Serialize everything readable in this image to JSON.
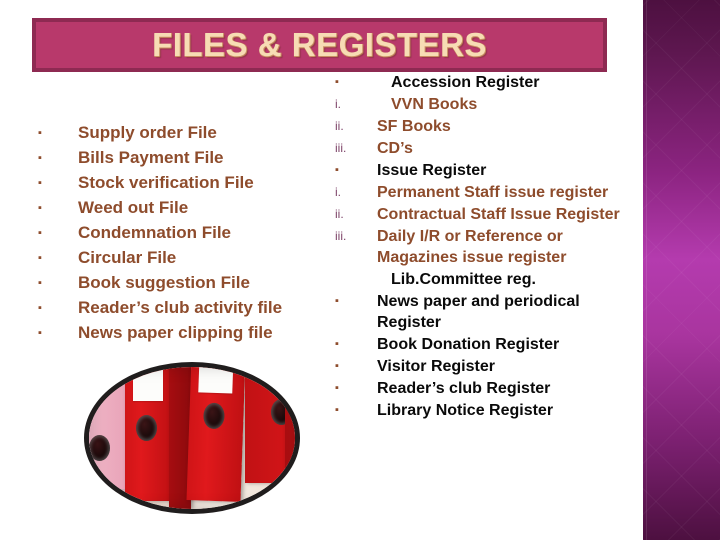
{
  "slide": {
    "title": "FILES & REGISTERS",
    "title_bg": "#b8396b",
    "title_border": "#8e2a52",
    "title_color": "#f7dcb4",
    "brown_text": "#8e4c2c",
    "black_text": "#0a0a0a",
    "band_color": "#b43bae"
  },
  "left_column": {
    "items": [
      {
        "marker": "▪",
        "text": "Supply order File"
      },
      {
        "marker": "▪",
        "text": "Bills Payment File"
      },
      {
        "marker": "▪",
        "text": "Stock verification File"
      },
      {
        "marker": "▪",
        "text": "Weed out  File"
      },
      {
        "marker": "▪",
        "text": "Condemnation File"
      },
      {
        "marker": "▪",
        "text": "Circular File"
      },
      {
        "marker": "▪",
        "text": "Book suggestion File"
      },
      {
        "marker": "▪",
        "text": "Reader’s club activity file"
      },
      {
        "marker": "▪",
        "text": "News paper clipping file"
      }
    ]
  },
  "right_column": {
    "items": [
      {
        "marker": "▪",
        "text": "Accession Register",
        "style": "black",
        "kind": "bullet",
        "indent": true
      },
      {
        "marker": "i.",
        "text": "VVN Books",
        "style": "brown",
        "kind": "numbered",
        "indent": true
      },
      {
        "marker": "ii.",
        "text": "SF Books",
        "style": "brown",
        "kind": "numbered",
        "indent": false
      },
      {
        "marker": "iii.",
        "text": "CD’s",
        "style": "brown",
        "kind": "numbered",
        "indent": false
      },
      {
        "marker": "▪",
        "text": "Issue  Register",
        "style": "black",
        "kind": "bullet",
        "indent": false
      },
      {
        "marker": "i.",
        "text": "Permanent Staff issue register",
        "style": "brown",
        "kind": "numbered",
        "indent": false
      },
      {
        "marker": "ii.",
        "text": "Contractual Staff Issue Register",
        "style": "brown",
        "kind": "numbered",
        "indent": false
      },
      {
        "marker": "iii.",
        "text": "Daily I/R or Reference or Magazines issue register",
        "style": "brown",
        "kind": "numbered",
        "indent": false
      },
      {
        "marker": "",
        "text": "Lib.Committee reg.",
        "style": "black",
        "kind": "none",
        "indent": true
      },
      {
        "marker": "▪",
        "text": "News paper and periodical Register",
        "style": "black",
        "kind": "bullet",
        "indent": false
      },
      {
        "marker": "▪",
        "text": "Book Donation Register",
        "style": "black",
        "kind": "bullet",
        "indent": false
      },
      {
        "marker": "▪",
        "text": "Visitor Register",
        "style": "black",
        "kind": "bullet",
        "indent": false
      },
      {
        "marker": "▪",
        "text": "Reader’s club Register",
        "style": "black",
        "kind": "bullet",
        "indent": false
      },
      {
        "marker": "▪",
        "text": "Library Notice Register",
        "style": "black",
        "kind": "bullet",
        "indent": false
      }
    ]
  },
  "photo": {
    "caption": "red ring binders on a shelf"
  }
}
